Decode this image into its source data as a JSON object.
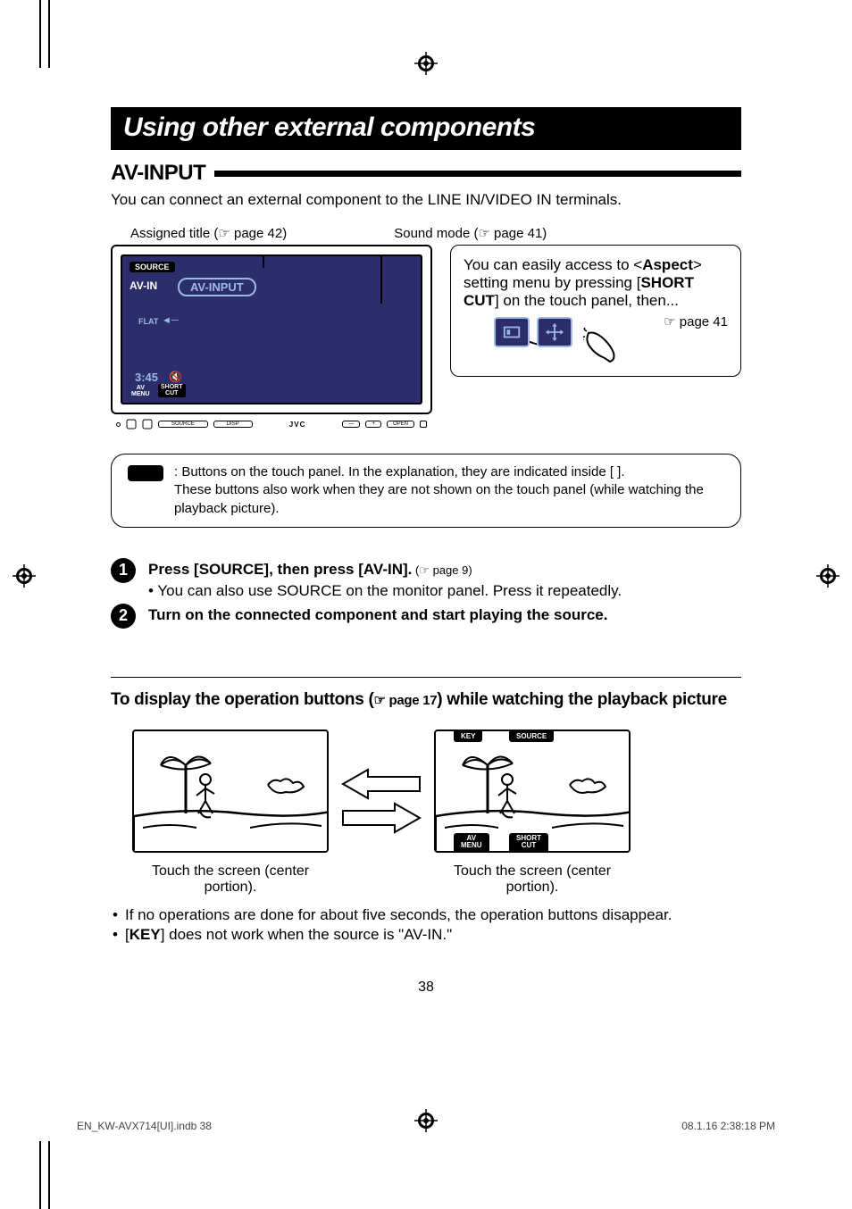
{
  "title": "Using other external components",
  "section": "AV-INPUT",
  "intro": "You can connect an external component to the LINE IN/VIDEO IN terminals.",
  "labels": {
    "assigned_title": "Assigned title (☞ page 42)",
    "sound_mode": "Sound mode (☞ page 41)"
  },
  "device": {
    "source_btn": "SOURCE",
    "avin": "AV-IN",
    "avinput": "AV-INPUT",
    "flat": "FLAT",
    "time": "3:45",
    "avmenu_line1": "AV",
    "avmenu_line2": "MENU",
    "shortcut_line1": "SHORT",
    "shortcut_line2": "CUT",
    "brand": "JVC",
    "panel_btns": {
      "source": "SOURCE",
      "disp": "DISP",
      "open": "OPEN",
      "minus": "—",
      "plus": "+"
    }
  },
  "sidebox": {
    "text_pre": "You can easily access to <",
    "text_bold1": "Aspect",
    "text_mid": "> setting menu by pressing [",
    "text_bold2": "SHORT CUT",
    "text_post": "] on the touch panel, then...",
    "page_ref": "☞ page 41"
  },
  "note": {
    "line1_pre": ":   Buttons on the touch panel. In the explanation, they are indicated inside [       ].",
    "line2": "These buttons also work when they are not shown on the touch panel (while watching the playback picture)."
  },
  "steps": {
    "s1_num": "1",
    "s1_bold": "Press [SOURCE], then press [AV-IN].",
    "s1_ref": " (☞ page 9)",
    "s1_sub": "•  You can also use SOURCE on the monitor panel. Press it repeatedly.",
    "s2_num": "2",
    "s2_bold": "Turn on the connected component and start playing the source."
  },
  "subhead": {
    "pre": "To display the operation buttons (",
    "ref": "☞ page 17",
    "post": ") while watching the playback picture"
  },
  "illust": {
    "caption1": "Touch the screen (center portion).",
    "caption2": "Touch the screen (center portion).",
    "btn_key": "KEY",
    "btn_source": "SOURCE",
    "btn_avmenu_l1": "AV",
    "btn_avmenu_l2": "MENU",
    "btn_shortcut_l1": "SHORT",
    "btn_shortcut_l2": "CUT"
  },
  "bullets": {
    "b1": "If no operations are done for about five seconds, the operation buttons disappear.",
    "b2_pre": "[",
    "b2_bold": "KEY",
    "b2_post": "] does not work when the source is \"AV-IN.\""
  },
  "page_number": "38",
  "footer": {
    "left": "EN_KW-AVX714[UI].indb   38",
    "right": "08.1.16   2:38:18 PM"
  }
}
